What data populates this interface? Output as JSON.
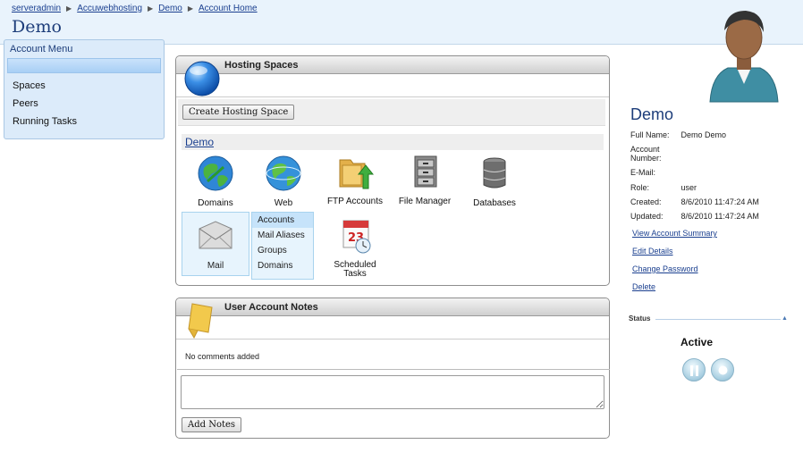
{
  "breadcrumb": [
    "serveradmin",
    "Accuwebhosting",
    "Demo",
    "Account Home"
  ],
  "page_title": "Demo",
  "account_menu": {
    "title": "Account Menu",
    "items": [
      "Spaces",
      "Peers",
      "Running Tasks"
    ]
  },
  "hosting_spaces": {
    "title": "Hosting Spaces",
    "create_button": "Create Hosting Space",
    "space_name": "Demo",
    "tiles": [
      {
        "label": "Domains",
        "icon": "globe-icon"
      },
      {
        "label": "Web",
        "icon": "web-globe-icon"
      },
      {
        "label": "FTP Accounts",
        "icon": "folder-upload-icon"
      },
      {
        "label": "File Manager",
        "icon": "file-cabinet-icon"
      },
      {
        "label": "Databases",
        "icon": "database-icon"
      }
    ],
    "mail": {
      "label": "Mail",
      "icon": "envelope-icon",
      "submenu": [
        "Accounts",
        "Mail Aliases",
        "Groups",
        "Domains"
      ],
      "selected": "Accounts"
    },
    "scheduled_tasks": {
      "label": "Scheduled Tasks",
      "icon": "calendar-clock-icon"
    }
  },
  "notes": {
    "title": "User Account Notes",
    "empty_text": "No comments added",
    "add_button": "Add Notes"
  },
  "profile": {
    "name": "Demo",
    "fields": [
      {
        "label": "Full Name:",
        "value": "Demo Demo"
      },
      {
        "label": "Account Number:",
        "value": ""
      },
      {
        "label": "E-Mail:",
        "value": ""
      },
      {
        "label": "Role:",
        "value": "user"
      },
      {
        "label": "Created:",
        "value": "8/6/2010 11:47:24 AM"
      },
      {
        "label": "Updated:",
        "value": "8/6/2010 11:47:24 AM"
      }
    ],
    "links": [
      "View Account Summary",
      "Edit Details",
      "Change Password",
      "Delete"
    ]
  },
  "status": {
    "label": "Status",
    "value": "Active"
  },
  "colors": {
    "header_bg": "#e9f3fc",
    "link": "#1a3f8f",
    "title": "#1d3d7a",
    "selection": "#c6e3fa"
  }
}
